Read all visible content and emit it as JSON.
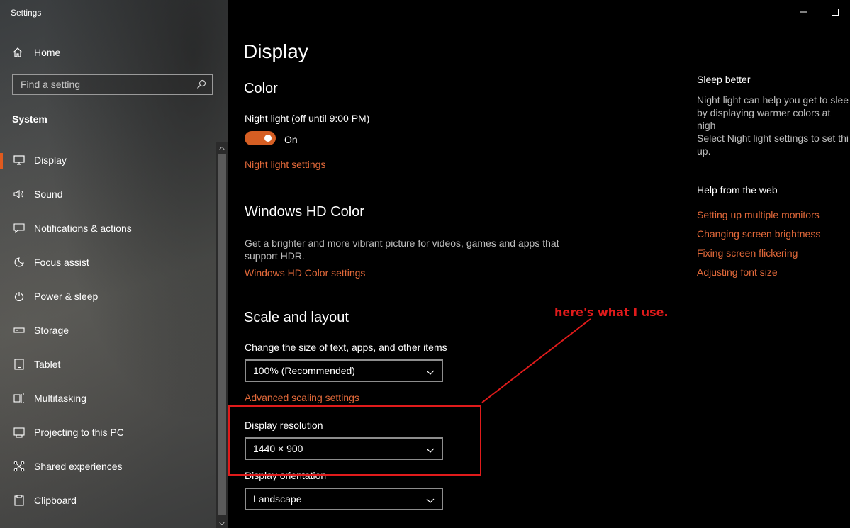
{
  "window": {
    "title": "Settings",
    "controls": [
      "minimize-icon",
      "maximize-icon"
    ]
  },
  "sidebar": {
    "home_label": "Home",
    "search_placeholder": "Find a setting",
    "section_label": "System",
    "items": [
      {
        "label": "Display",
        "icon": "display-icon",
        "active": true
      },
      {
        "label": "Sound",
        "icon": "speaker-icon"
      },
      {
        "label": "Notifications & actions",
        "icon": "notification-icon"
      },
      {
        "label": "Focus assist",
        "icon": "moon-icon"
      },
      {
        "label": "Power & sleep",
        "icon": "power-icon"
      },
      {
        "label": "Storage",
        "icon": "storage-icon"
      },
      {
        "label": "Tablet",
        "icon": "tablet-icon"
      },
      {
        "label": "Multitasking",
        "icon": "multitasking-icon"
      },
      {
        "label": "Projecting to this PC",
        "icon": "projector-icon"
      },
      {
        "label": "Shared experiences",
        "icon": "shared-icon"
      },
      {
        "label": "Clipboard",
        "icon": "clipboard-icon"
      }
    ]
  },
  "main": {
    "page_title": "Display",
    "color": {
      "heading": "Color",
      "night_light_label": "Night light (off until 9:00 PM)",
      "toggle_state": "On",
      "night_light_link": "Night light settings"
    },
    "hd_color": {
      "heading": "Windows HD Color",
      "description": "Get a brighter and more vibrant picture for videos, games and apps that support HDR.",
      "link": "Windows HD Color settings"
    },
    "scale_layout": {
      "heading": "Scale and layout",
      "scale_label": "Change the size of text, apps, and other items",
      "scale_value": "100% (Recommended)",
      "advanced_link": "Advanced scaling settings",
      "resolution_label": "Display resolution",
      "resolution_value": "1440 × 900",
      "orientation_label": "Display orientation",
      "orientation_value": "Landscape"
    }
  },
  "right_panel": {
    "sleep_heading": "Sleep better",
    "sleep_text": [
      "Night light can help you get to slee",
      "by displaying warmer colors at nigh",
      "Select Night light settings to set thi",
      "up."
    ],
    "help_heading": "Help from the web",
    "help_links": [
      "Setting up multiple monitors",
      "Changing screen brightness",
      "Fixing screen flickering",
      "Adjusting font size"
    ]
  },
  "annotation": {
    "text": "here's what I use.",
    "color": "#e01b1b"
  },
  "colors": {
    "accent": "#e2693a",
    "toggle_on": "#d55e23",
    "annotation_red": "#e01b1b"
  }
}
